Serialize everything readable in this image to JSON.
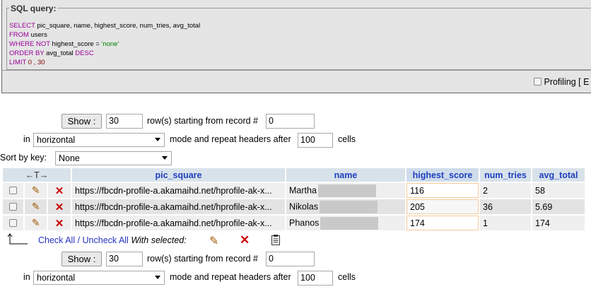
{
  "sql": {
    "legend": "SQL query:",
    "kw_select": "SELECT",
    "select_cols": " pic_square, name, highest_score, num_tries, avg_total",
    "kw_from": "FROM",
    "from_table": " users",
    "kw_where_not": "WHERE NOT",
    "where_col": " highest_score = ",
    "where_val": "'none'",
    "kw_order_by": "ORDER BY",
    "order_col": " avg_total ",
    "kw_desc": "DESC",
    "kw_limit": "LIMIT",
    "limit_vals": " 0 , 30",
    "profiling_label": "Profiling [ E"
  },
  "nav_top": {
    "show_label": "Show :",
    "rows_value": "30",
    "starting_text": "row(s) starting from record #",
    "start_value": "0",
    "in_label": "in",
    "mode_value": "horizontal",
    "repeat_text": "mode and repeat headers after",
    "repeat_value": "100",
    "cells_text": "cells"
  },
  "sort": {
    "label": "Sort by key:",
    "value": "None"
  },
  "table": {
    "columns": [
      "pic_square",
      "name",
      "highest_score",
      "num_tries",
      "avg_total"
    ],
    "rows": [
      {
        "pic_square": "https://fbcdn-profile-a.akamaihd.net/hprofile-ak-x...",
        "name": "Martha",
        "highest_score": "116",
        "num_tries": "2",
        "avg_total": "58"
      },
      {
        "pic_square": "https://fbcdn-profile-a.akamaihd.net/hprofile-ak-x...",
        "name": "Nikolas",
        "highest_score": "205",
        "num_tries": "36",
        "avg_total": "5.69"
      },
      {
        "pic_square": "https://fbcdn-profile-a.akamaihd.net/hprofile-ak-x...",
        "name": "Phanos",
        "highest_score": "174",
        "num_tries": "1",
        "avg_total": "174"
      }
    ]
  },
  "bulk": {
    "check_all": "Check All",
    "separator": " / ",
    "uncheck_all": "Uncheck All",
    "with_selected": "With selected:"
  },
  "nav_bottom": {
    "show_label": "Show :",
    "rows_value": "30",
    "starting_text": "row(s) starting from record #",
    "start_value": "0",
    "in_label": "in",
    "mode_value": "horizontal",
    "repeat_text": "mode and repeat headers after",
    "repeat_value": "100",
    "cells_text": "cells"
  }
}
